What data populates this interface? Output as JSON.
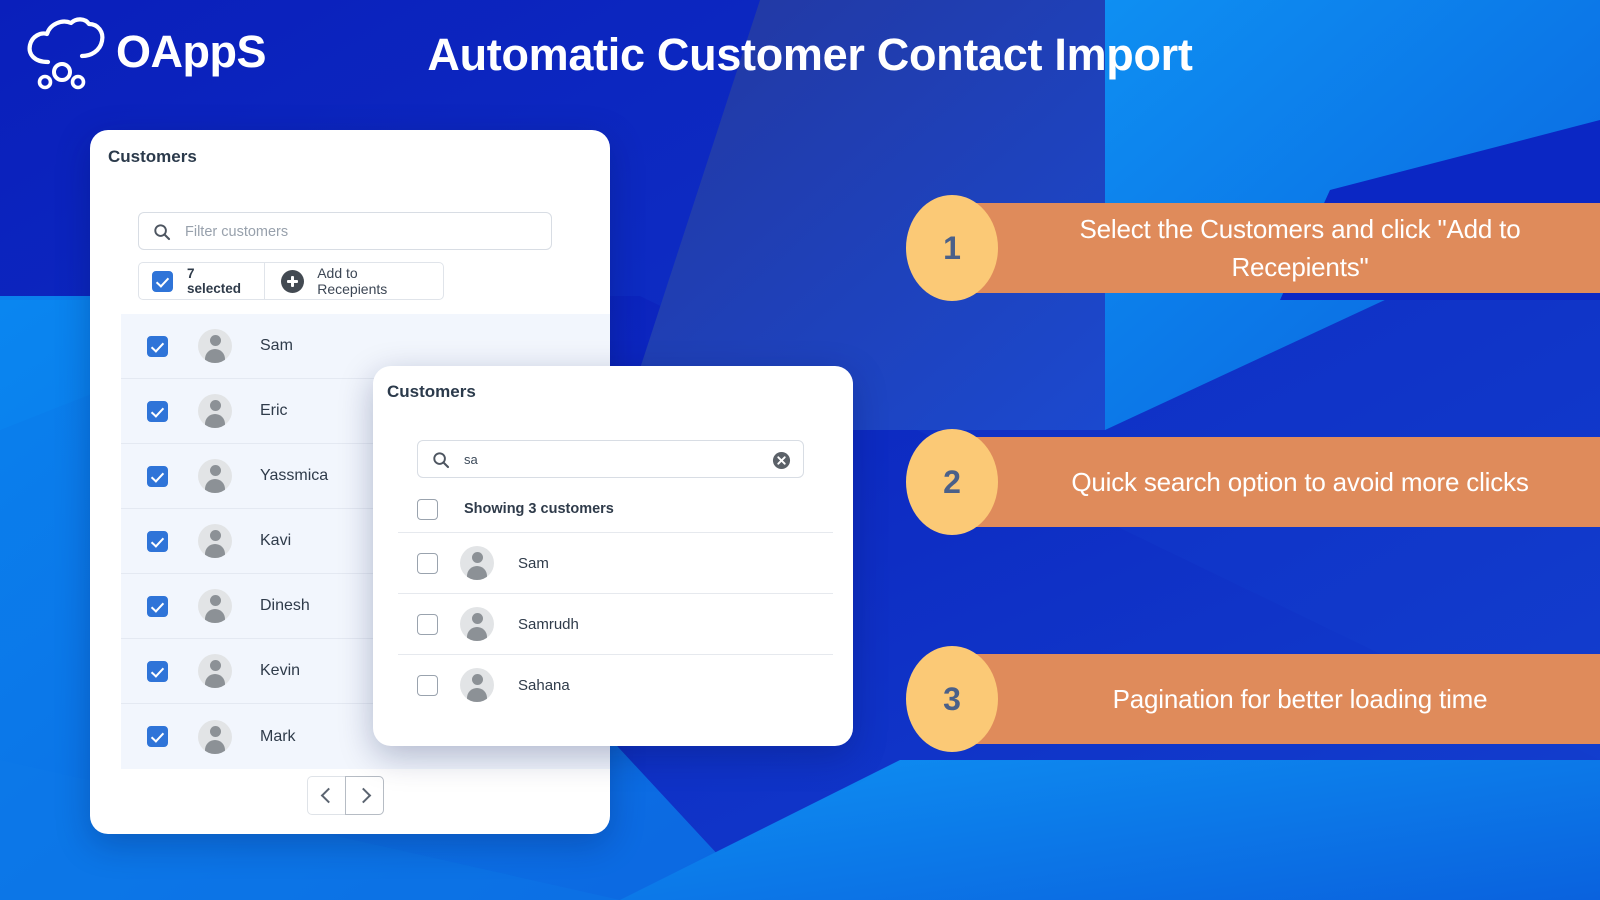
{
  "brand": {
    "logo_icon": "cloud-icon",
    "name": "OAppS"
  },
  "header": {
    "title": "Automatic Customer Contact Import"
  },
  "colors": {
    "bg_deep_blue": "#0b22bd",
    "bg_mid_blue": "#1448d6",
    "bg_light_blue": "#0b82ee",
    "bg_navy": "#1f3ab5",
    "callout_bg": "#df8b5b",
    "callout_badge": "#fbc976",
    "badge_number": "#4a6089",
    "checkbox_checked": "#2f74d8",
    "row_bg": "#f2f6fd"
  },
  "customers_card": {
    "title": "Customers",
    "filter": {
      "icon": "search-icon",
      "placeholder": "Filter customers",
      "value": ""
    },
    "toolbar": {
      "checkbox_state": "checked",
      "selected_label": "7 selected",
      "add_icon": "plus-circle-icon",
      "add_label": "Add to Recepients"
    },
    "rows": [
      {
        "name": "Sam",
        "checked": true
      },
      {
        "name": "Eric",
        "checked": true
      },
      {
        "name": "Yassmica",
        "checked": true
      },
      {
        "name": "Kavi",
        "checked": true
      },
      {
        "name": "Dinesh",
        "checked": true
      },
      {
        "name": "Kevin",
        "checked": true
      },
      {
        "name": "Mark",
        "checked": true
      }
    ],
    "pagination": {
      "prev_icon": "chevron-left-icon",
      "next_icon": "chevron-right-icon"
    }
  },
  "search_card": {
    "title": "Customers",
    "search": {
      "icon": "search-icon",
      "value": "sa",
      "placeholder": "Filter customers",
      "clear_icon": "clear-circle-icon"
    },
    "results_header": {
      "checkbox_state": "unchecked",
      "label": "Showing 3 customers"
    },
    "rows": [
      {
        "name": "Sam",
        "checked": false
      },
      {
        "name": "Samrudh",
        "checked": false
      },
      {
        "name": "Sahana",
        "checked": false
      }
    ]
  },
  "callouts": [
    {
      "number": "1",
      "text": "Select the Customers and click \"Add to Recepients\""
    },
    {
      "number": "2",
      "text": "Quick search option to avoid more clicks"
    },
    {
      "number": "3",
      "text": "Pagination for better loading time"
    }
  ]
}
